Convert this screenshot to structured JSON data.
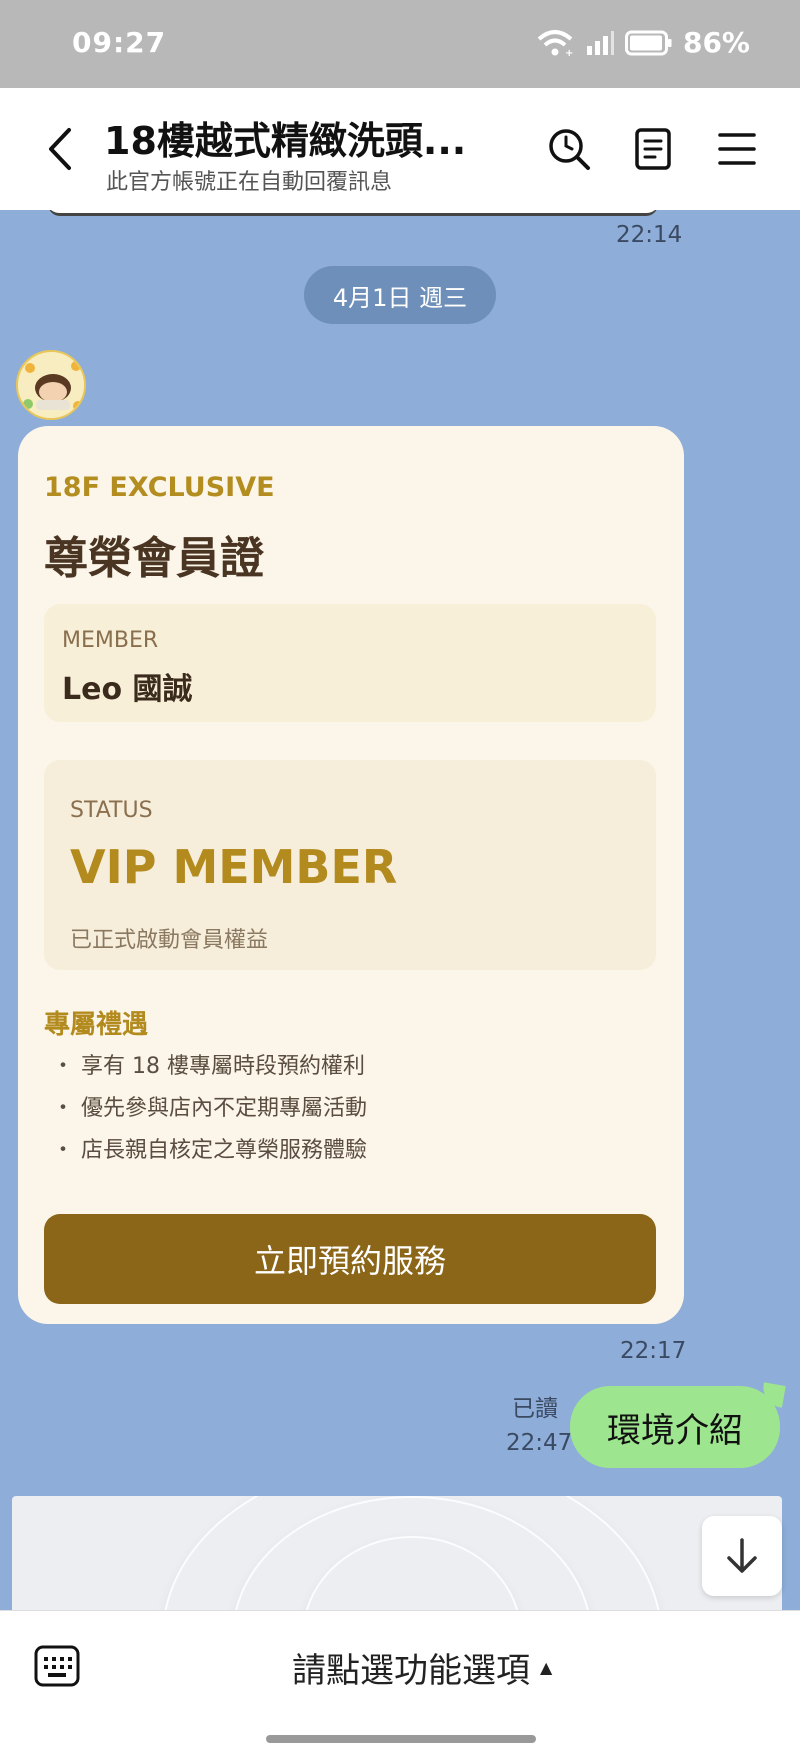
{
  "status_bar": {
    "time": "09:27",
    "battery": "86%"
  },
  "header": {
    "title": "18樓越式精緻洗頭...",
    "subtitle": "此官方帳號正在自動回覆訊息",
    "icons": [
      "back-icon",
      "search-history-icon",
      "notes-icon",
      "menu-icon"
    ]
  },
  "chat": {
    "prev_time": "22:14",
    "date_divider": "4月1日 週三",
    "card": {
      "eyebrow": "18F EXCLUSIVE",
      "title": "尊榮會員證",
      "member_label": "MEMBER",
      "member_name": "Leo 國誠",
      "status_label": "STATUS",
      "status_value": "VIP MEMBER",
      "status_note": "已正式啟動會員權益",
      "perks_title": "專屬禮遇",
      "perks": [
        "・ 享有 18 樓專屬時段預約權利",
        "・ 優先參與店內不定期專屬活動",
        "・ 店長親自核定之尊榮服務體驗"
      ],
      "button": "立即預約服務"
    },
    "card_time": "22:17",
    "outgoing": {
      "read": "已讀",
      "time": "22:47",
      "text": "環境介紹"
    }
  },
  "bottom_bar": {
    "menu_label": "請點選功能選項",
    "caret": "▲"
  },
  "colors": {
    "chat_bg": "#8eadd8",
    "card_bg": "#fbf6e9",
    "gold": "#b38a1d",
    "button": "#8b6518",
    "out_bubble": "#9ee58f"
  }
}
